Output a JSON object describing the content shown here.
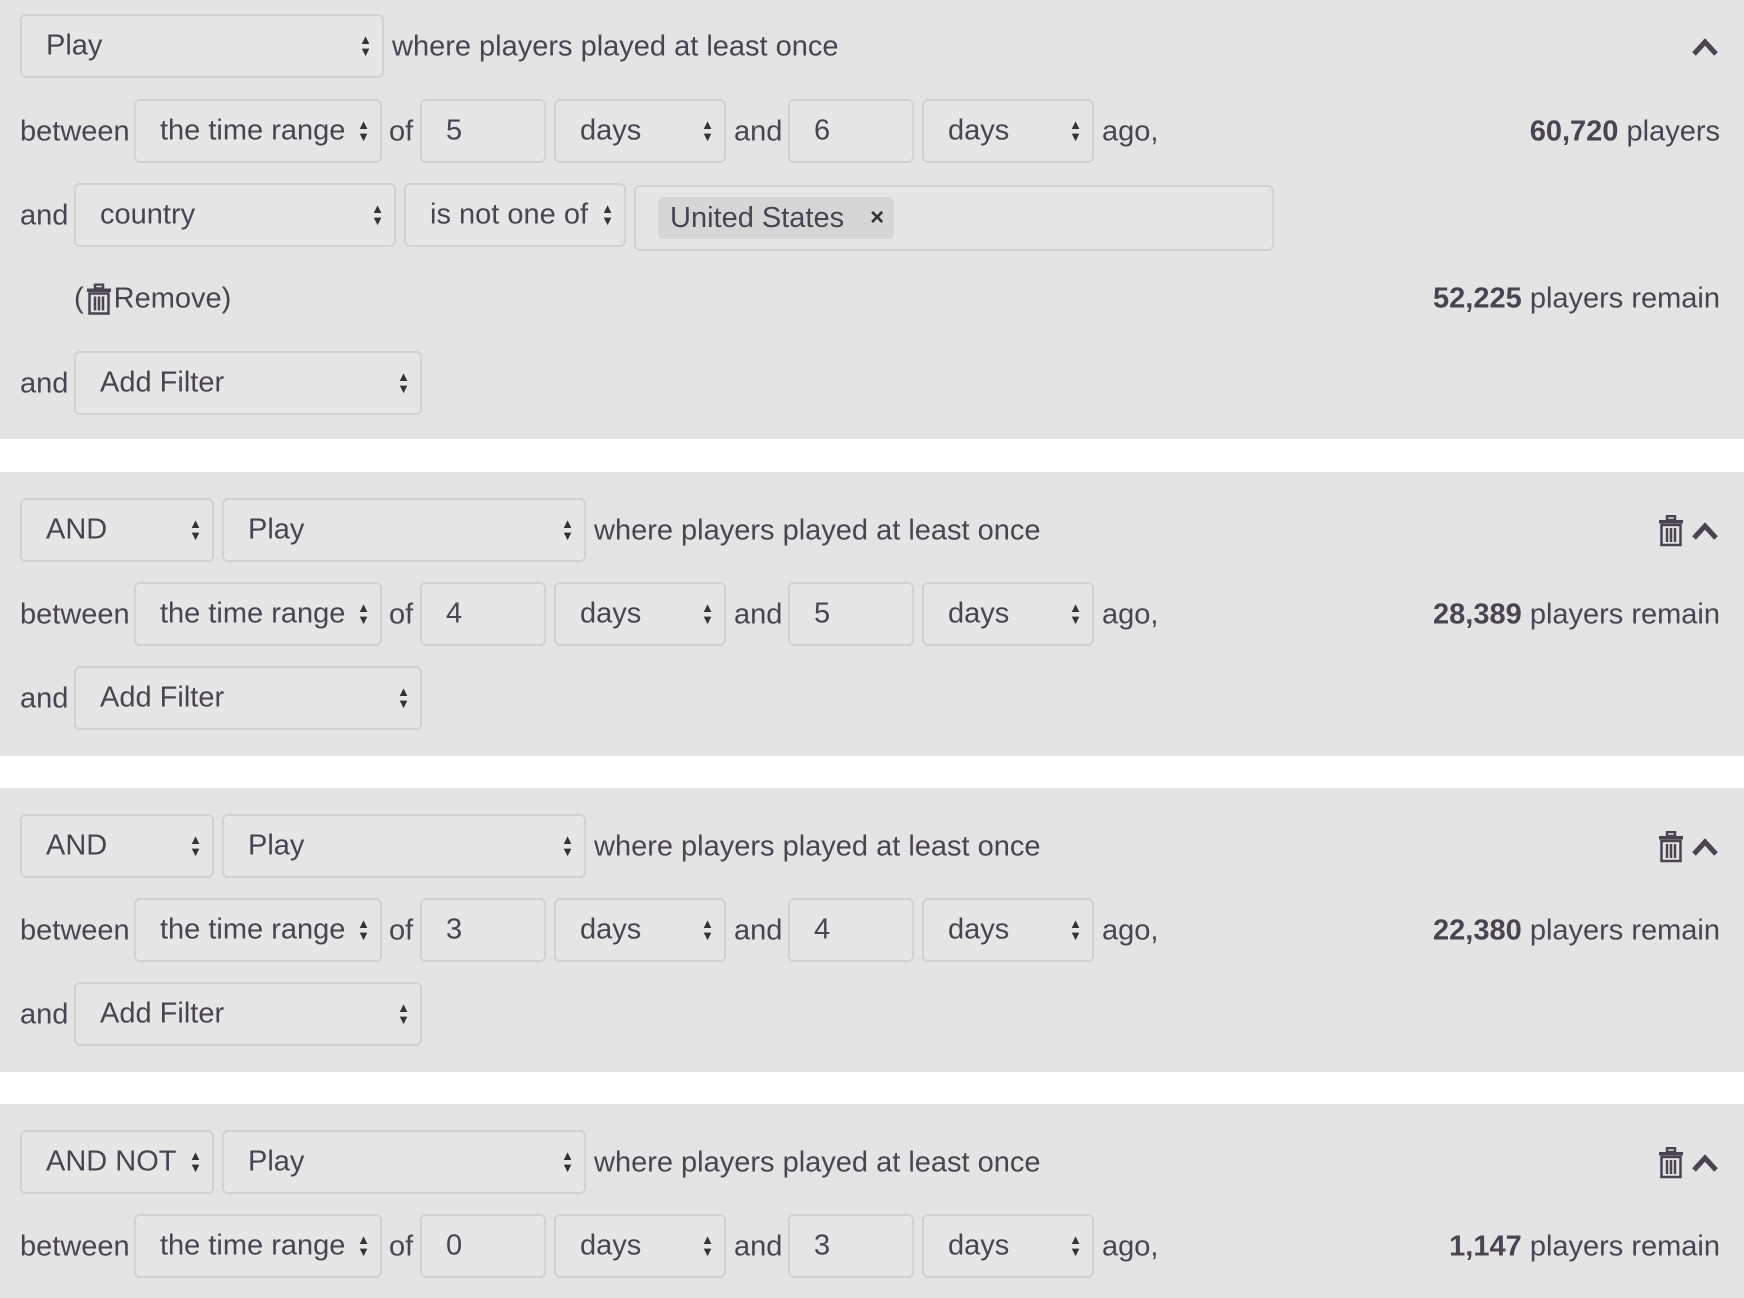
{
  "blocks": [
    {
      "event": "Play",
      "event_desc": "where players played at least once",
      "between_label": "between",
      "range_type": "the time range",
      "of_label": "of",
      "from_value": "5",
      "from_unit": "days",
      "and_label": "and",
      "to_value": "6",
      "to_unit": "days",
      "ago_label": "ago,",
      "count": "60,720",
      "count_suffix": "players",
      "filter": {
        "and_label": "and",
        "field": "country",
        "operator": "is not one of",
        "tag": "United States",
        "tag_remove": "×",
        "remove_label": "Remove)",
        "remove_paren": "(",
        "remain_count": "52,225",
        "remain_suffix": "players remain"
      },
      "add_filter": {
        "and_label": "and",
        "label": "Add Filter"
      }
    },
    {
      "operator": "AND",
      "event": "Play",
      "event_desc": "where players played at least once",
      "between_label": "between",
      "range_type": "the time range",
      "of_label": "of",
      "from_value": "4",
      "from_unit": "days",
      "and_label": "and",
      "to_value": "5",
      "to_unit": "days",
      "ago_label": "ago,",
      "count": "28,389",
      "count_suffix": "players remain",
      "add_filter": {
        "and_label": "and",
        "label": "Add Filter"
      }
    },
    {
      "operator": "AND",
      "event": "Play",
      "event_desc": "where players played at least once",
      "between_label": "between",
      "range_type": "the time range",
      "of_label": "of",
      "from_value": "3",
      "from_unit": "days",
      "and_label": "and",
      "to_value": "4",
      "to_unit": "days",
      "ago_label": "ago,",
      "count": "22,380",
      "count_suffix": "players remain",
      "add_filter": {
        "and_label": "and",
        "label": "Add Filter"
      }
    },
    {
      "operator": "AND NOT",
      "event": "Play",
      "event_desc": "where players played at least once",
      "between_label": "between",
      "range_type": "the time range",
      "of_label": "of",
      "from_value": "0",
      "from_unit": "days",
      "and_label": "and",
      "to_value": "3",
      "to_unit": "days",
      "ago_label": "ago,",
      "count": "1,147",
      "count_suffix": "players remain"
    }
  ],
  "icons": {
    "trash": "trash-icon",
    "collapse": "chevron-up-icon",
    "select": "updown-arrows-icon",
    "tag_close": "close-icon"
  },
  "colors": {
    "panel_bg": "#e4e4e4",
    "text": "#4a4450",
    "control_bg": "#e6e6e6",
    "control_border": "#d2d2d2"
  }
}
